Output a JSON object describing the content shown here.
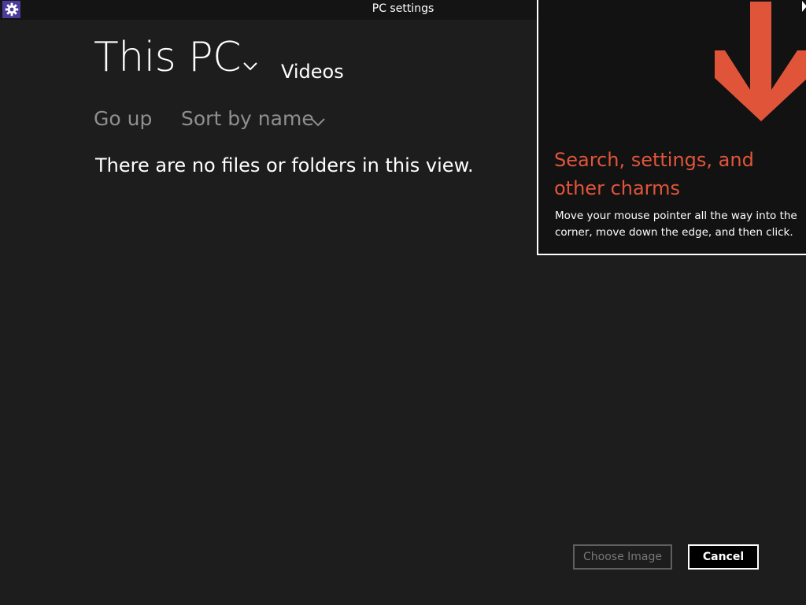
{
  "window": {
    "title": "PC settings",
    "app_icon": "gear-icon"
  },
  "location": {
    "title": "This PC",
    "folder": "Videos",
    "dropdown_icon": "chevron-down-icon"
  },
  "toolbar": {
    "go_up_label": "Go up",
    "sort_label": "Sort by name",
    "sort_icon": "chevron-down-icon"
  },
  "content": {
    "empty_message": "There are no files or folders in this view."
  },
  "charms_tip": {
    "heading_line1": "Search, settings, and",
    "heading_line2": "other charms",
    "body": "Move your mouse pointer all the way into the corner, move down the edge, and then click.",
    "arrow_icon": "arrow-down-icon",
    "accent_color": "#e0553a"
  },
  "footer": {
    "choose_label": "Choose Image",
    "cancel_label": "Cancel"
  }
}
